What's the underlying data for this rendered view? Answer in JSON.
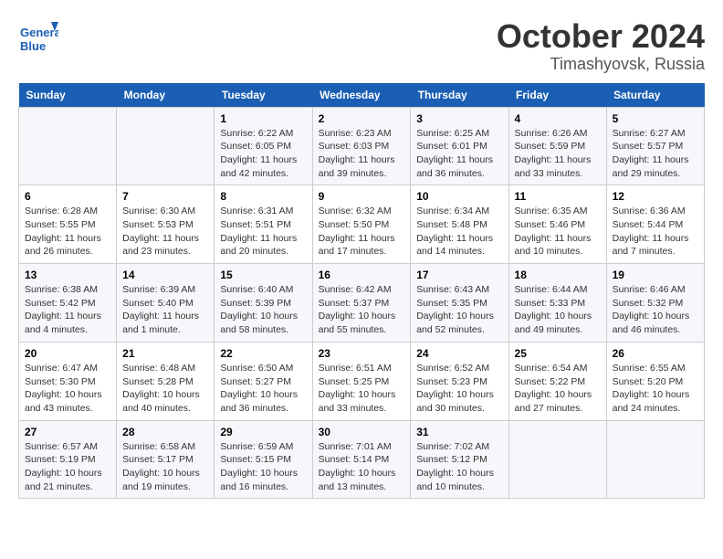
{
  "logo": {
    "line1": "General",
    "line2": "Blue"
  },
  "title": "October 2024",
  "location": "Timashyovsk, Russia",
  "weekdays": [
    "Sunday",
    "Monday",
    "Tuesday",
    "Wednesday",
    "Thursday",
    "Friday",
    "Saturday"
  ],
  "weeks": [
    [
      {
        "day": "",
        "info": ""
      },
      {
        "day": "",
        "info": ""
      },
      {
        "day": "1",
        "info": "Sunrise: 6:22 AM\nSunset: 6:05 PM\nDaylight: 11 hours\nand 42 minutes."
      },
      {
        "day": "2",
        "info": "Sunrise: 6:23 AM\nSunset: 6:03 PM\nDaylight: 11 hours\nand 39 minutes."
      },
      {
        "day": "3",
        "info": "Sunrise: 6:25 AM\nSunset: 6:01 PM\nDaylight: 11 hours\nand 36 minutes."
      },
      {
        "day": "4",
        "info": "Sunrise: 6:26 AM\nSunset: 5:59 PM\nDaylight: 11 hours\nand 33 minutes."
      },
      {
        "day": "5",
        "info": "Sunrise: 6:27 AM\nSunset: 5:57 PM\nDaylight: 11 hours\nand 29 minutes."
      }
    ],
    [
      {
        "day": "6",
        "info": "Sunrise: 6:28 AM\nSunset: 5:55 PM\nDaylight: 11 hours\nand 26 minutes."
      },
      {
        "day": "7",
        "info": "Sunrise: 6:30 AM\nSunset: 5:53 PM\nDaylight: 11 hours\nand 23 minutes."
      },
      {
        "day": "8",
        "info": "Sunrise: 6:31 AM\nSunset: 5:51 PM\nDaylight: 11 hours\nand 20 minutes."
      },
      {
        "day": "9",
        "info": "Sunrise: 6:32 AM\nSunset: 5:50 PM\nDaylight: 11 hours\nand 17 minutes."
      },
      {
        "day": "10",
        "info": "Sunrise: 6:34 AM\nSunset: 5:48 PM\nDaylight: 11 hours\nand 14 minutes."
      },
      {
        "day": "11",
        "info": "Sunrise: 6:35 AM\nSunset: 5:46 PM\nDaylight: 11 hours\nand 10 minutes."
      },
      {
        "day": "12",
        "info": "Sunrise: 6:36 AM\nSunset: 5:44 PM\nDaylight: 11 hours\nand 7 minutes."
      }
    ],
    [
      {
        "day": "13",
        "info": "Sunrise: 6:38 AM\nSunset: 5:42 PM\nDaylight: 11 hours\nand 4 minutes."
      },
      {
        "day": "14",
        "info": "Sunrise: 6:39 AM\nSunset: 5:40 PM\nDaylight: 11 hours\nand 1 minute."
      },
      {
        "day": "15",
        "info": "Sunrise: 6:40 AM\nSunset: 5:39 PM\nDaylight: 10 hours\nand 58 minutes."
      },
      {
        "day": "16",
        "info": "Sunrise: 6:42 AM\nSunset: 5:37 PM\nDaylight: 10 hours\nand 55 minutes."
      },
      {
        "day": "17",
        "info": "Sunrise: 6:43 AM\nSunset: 5:35 PM\nDaylight: 10 hours\nand 52 minutes."
      },
      {
        "day": "18",
        "info": "Sunrise: 6:44 AM\nSunset: 5:33 PM\nDaylight: 10 hours\nand 49 minutes."
      },
      {
        "day": "19",
        "info": "Sunrise: 6:46 AM\nSunset: 5:32 PM\nDaylight: 10 hours\nand 46 minutes."
      }
    ],
    [
      {
        "day": "20",
        "info": "Sunrise: 6:47 AM\nSunset: 5:30 PM\nDaylight: 10 hours\nand 43 minutes."
      },
      {
        "day": "21",
        "info": "Sunrise: 6:48 AM\nSunset: 5:28 PM\nDaylight: 10 hours\nand 40 minutes."
      },
      {
        "day": "22",
        "info": "Sunrise: 6:50 AM\nSunset: 5:27 PM\nDaylight: 10 hours\nand 36 minutes."
      },
      {
        "day": "23",
        "info": "Sunrise: 6:51 AM\nSunset: 5:25 PM\nDaylight: 10 hours\nand 33 minutes."
      },
      {
        "day": "24",
        "info": "Sunrise: 6:52 AM\nSunset: 5:23 PM\nDaylight: 10 hours\nand 30 minutes."
      },
      {
        "day": "25",
        "info": "Sunrise: 6:54 AM\nSunset: 5:22 PM\nDaylight: 10 hours\nand 27 minutes."
      },
      {
        "day": "26",
        "info": "Sunrise: 6:55 AM\nSunset: 5:20 PM\nDaylight: 10 hours\nand 24 minutes."
      }
    ],
    [
      {
        "day": "27",
        "info": "Sunrise: 6:57 AM\nSunset: 5:19 PM\nDaylight: 10 hours\nand 21 minutes."
      },
      {
        "day": "28",
        "info": "Sunrise: 6:58 AM\nSunset: 5:17 PM\nDaylight: 10 hours\nand 19 minutes."
      },
      {
        "day": "29",
        "info": "Sunrise: 6:59 AM\nSunset: 5:15 PM\nDaylight: 10 hours\nand 16 minutes."
      },
      {
        "day": "30",
        "info": "Sunrise: 7:01 AM\nSunset: 5:14 PM\nDaylight: 10 hours\nand 13 minutes."
      },
      {
        "day": "31",
        "info": "Sunrise: 7:02 AM\nSunset: 5:12 PM\nDaylight: 10 hours\nand 10 minutes."
      },
      {
        "day": "",
        "info": ""
      },
      {
        "day": "",
        "info": ""
      }
    ]
  ]
}
